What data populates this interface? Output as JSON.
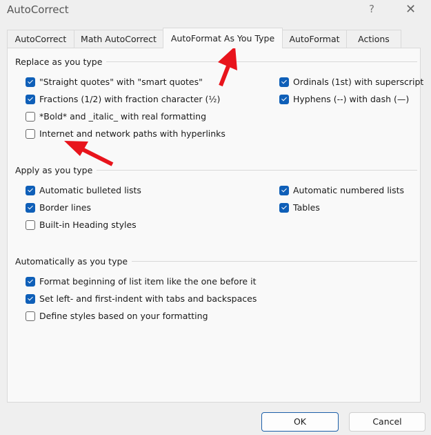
{
  "window": {
    "title": "AutoCorrect",
    "help_label": "?",
    "close_label": "✕"
  },
  "tabs": [
    {
      "label": "AutoCorrect",
      "active": false
    },
    {
      "label": "Math AutoCorrect",
      "active": false
    },
    {
      "label": "AutoFormat As You Type",
      "active": true
    },
    {
      "label": "AutoFormat",
      "active": false
    },
    {
      "label": "Actions",
      "active": false
    }
  ],
  "groups": {
    "replace": {
      "title": "Replace as you type",
      "items": [
        {
          "label": "\"Straight quotes\" with \"smart quotes\"",
          "checked": true
        },
        {
          "label": "Fractions (1/2) with fraction character (½)",
          "checked": true
        },
        {
          "label": "*Bold* and _italic_ with real formatting",
          "checked": false
        },
        {
          "label": "Internet and network paths with hyperlinks",
          "checked": false
        },
        {
          "label": "Ordinals (1st) with superscript",
          "checked": true
        },
        {
          "label": "Hyphens (--) with dash (—)",
          "checked": true
        }
      ]
    },
    "apply": {
      "title": "Apply as you type",
      "items": [
        {
          "label": "Automatic bulleted lists",
          "checked": true
        },
        {
          "label": "Border lines",
          "checked": true
        },
        {
          "label": "Built-in Heading styles",
          "checked": false
        },
        {
          "label": "Automatic numbered lists",
          "checked": true
        },
        {
          "label": "Tables",
          "checked": true
        }
      ]
    },
    "auto": {
      "title": "Automatically as you type",
      "items": [
        {
          "label": "Format beginning of list item like the one before it",
          "checked": true
        },
        {
          "label": "Set left- and first-indent with tabs and backspaces",
          "checked": true
        },
        {
          "label": "Define styles based on your formatting",
          "checked": false
        }
      ]
    }
  },
  "buttons": {
    "ok": "OK",
    "cancel": "Cancel"
  },
  "annotations": {
    "arrow_color": "#e8141c",
    "checkbox_color": "#0f5fb8"
  }
}
